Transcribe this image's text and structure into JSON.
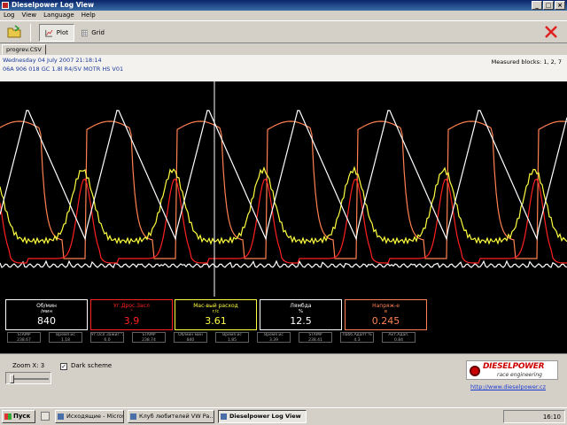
{
  "window": {
    "title": "Dieselpower Log View",
    "buttons": [
      "_",
      "□",
      "×"
    ]
  },
  "menu": [
    "Log",
    "View",
    "Language",
    "Help"
  ],
  "toolbar": {
    "plot_label": "Plot",
    "grid_label": "Grid"
  },
  "tab": {
    "label": "progrev.CSV"
  },
  "info": {
    "date": "Wednesday 04 July 2007 21:18:14",
    "ecu": "06A 906 018 GC  1.8l R4/5V  MOTR HS V01",
    "blocks": "Measured blocks: 1, 2, 7"
  },
  "colors": {
    "plot_bg": "#000000",
    "rpm": "#ffffff",
    "throttle": "#ff2020",
    "maf": "#ffff40",
    "lambda": "#ffffff",
    "voltage": "#ff8050"
  },
  "gauges": [
    {
      "title": "Об/мин",
      "unit": "/мин",
      "value": "840",
      "color": "#ffffff"
    },
    {
      "title": "Уг.Дрос.Засл",
      "unit": "°",
      "value": "3.9",
      "color": "#ff2020"
    },
    {
      "title": "Мас-вый расход",
      "unit": "г/с",
      "value": "3.61",
      "color": "#ffff40"
    },
    {
      "title": "Лямбда",
      "unit": "%",
      "value": "12.5",
      "color": "#ffffff"
    },
    {
      "title": "Напряж-е",
      "unit": "в",
      "value": "0.245",
      "color": "#ff8050"
    }
  ],
  "subs": [
    {
      "l1": "STAMP",
      "l2": "238.67"
    },
    {
      "l1": "Время ис",
      "l2": "1.18"
    },
    {
      "l1": "Уг.Осл.Зажиг.\"АТ",
      "l2": "6.0"
    },
    {
      "l1": "STAMP",
      "l2": "238.74"
    },
    {
      "l1": "Об/мин мин",
      "l2": "840"
    },
    {
      "l1": "Время ис",
      "l2": "1.85"
    },
    {
      "l1": "Время ис",
      "l2": "3.39"
    },
    {
      "l1": "STAMP",
      "l2": "238.41"
    },
    {
      "l1": "Лабб.Адапт.%",
      "l2": "4.3"
    },
    {
      "l1": "Акт.Адап.",
      "l2": "0.84"
    }
  ],
  "bottom": {
    "zoom_label": "Zoom X: 3",
    "dark_label": "Dark scheme",
    "dark_checked": "✓",
    "logo_name": "DIESELPOWER",
    "logo_sub": "race engineering",
    "url": "http://www.dieselpower.cz"
  },
  "taskbar": {
    "start": "Пуск",
    "tasks": [
      {
        "label": "Исходящие - Microsoft ...",
        "active": false
      },
      {
        "label": "Клуб любителей VW Pa...",
        "active": false
      },
      {
        "label": "Dieselpower Log View",
        "active": true
      }
    ],
    "clock": "16:10"
  }
}
